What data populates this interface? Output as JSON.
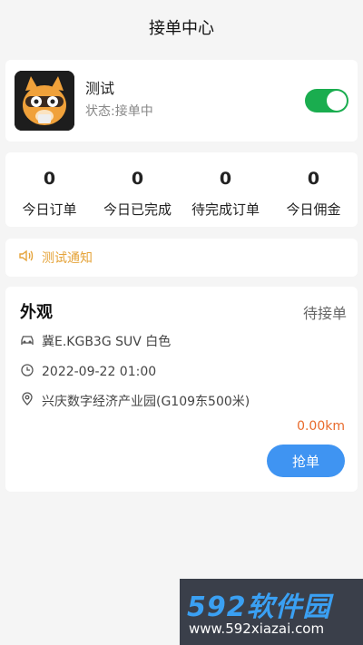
{
  "header": {
    "title": "接单中心"
  },
  "profile": {
    "name": "测试",
    "status": "状态:接单中",
    "online": true
  },
  "stats": [
    {
      "value": "0",
      "label": "今日订单"
    },
    {
      "value": "0",
      "label": "今日已完成"
    },
    {
      "value": "0",
      "label": "待完成订单"
    },
    {
      "value": "0",
      "label": "今日佣金"
    }
  ],
  "notice": {
    "text": "测试通知",
    "icon": "speaker-icon"
  },
  "order": {
    "title": "外观",
    "status": "待接单",
    "vehicle": "冀E.KGB3G SUV 白色",
    "time": "2022-09-22 01:00",
    "address": "兴庆数字经济产业园(G109东500米)",
    "distance": "0.00km",
    "grab_label": "抢单"
  },
  "watermark": {
    "logo": "592软件园",
    "url": "www.592xiazai.com"
  },
  "colors": {
    "accent": "#3f94f2",
    "toggle_on": "#1aad4f",
    "notice": "#e5a43b",
    "distance": "#e86a2b"
  }
}
